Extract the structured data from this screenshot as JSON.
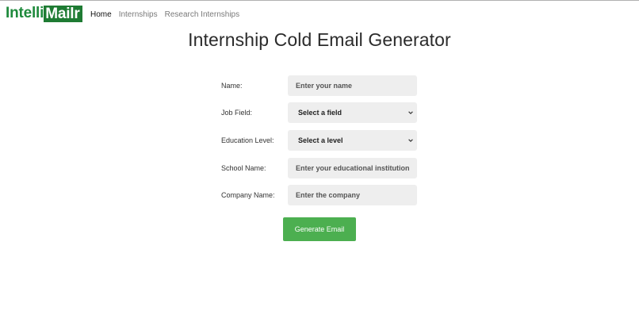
{
  "navbar": {
    "brand_part1": "Intelli",
    "brand_part2": "Mailr",
    "links": [
      {
        "label": "Home"
      },
      {
        "label": "Internships"
      },
      {
        "label": "Research Internships"
      }
    ]
  },
  "page": {
    "title": "Internship Cold Email Generator"
  },
  "form": {
    "name": {
      "label": "Name:",
      "placeholder": "Enter your name",
      "value": ""
    },
    "job_field": {
      "label": "Job Field:",
      "selected": "Select a field"
    },
    "education": {
      "label": "Education Level:",
      "selected": "Select a level"
    },
    "school": {
      "label": "School Name:",
      "placeholder": "Enter your educational institution",
      "value": ""
    },
    "company": {
      "label": "Company Name:",
      "placeholder": "Enter the company",
      "value": ""
    },
    "submit_label": "Generate Email"
  },
  "colors": {
    "brand_green": "#1e7b33",
    "button_green": "#4caf50",
    "field_bg": "#eeeeee"
  },
  "icons": {
    "select_arrow": "chevron-down-icon"
  }
}
